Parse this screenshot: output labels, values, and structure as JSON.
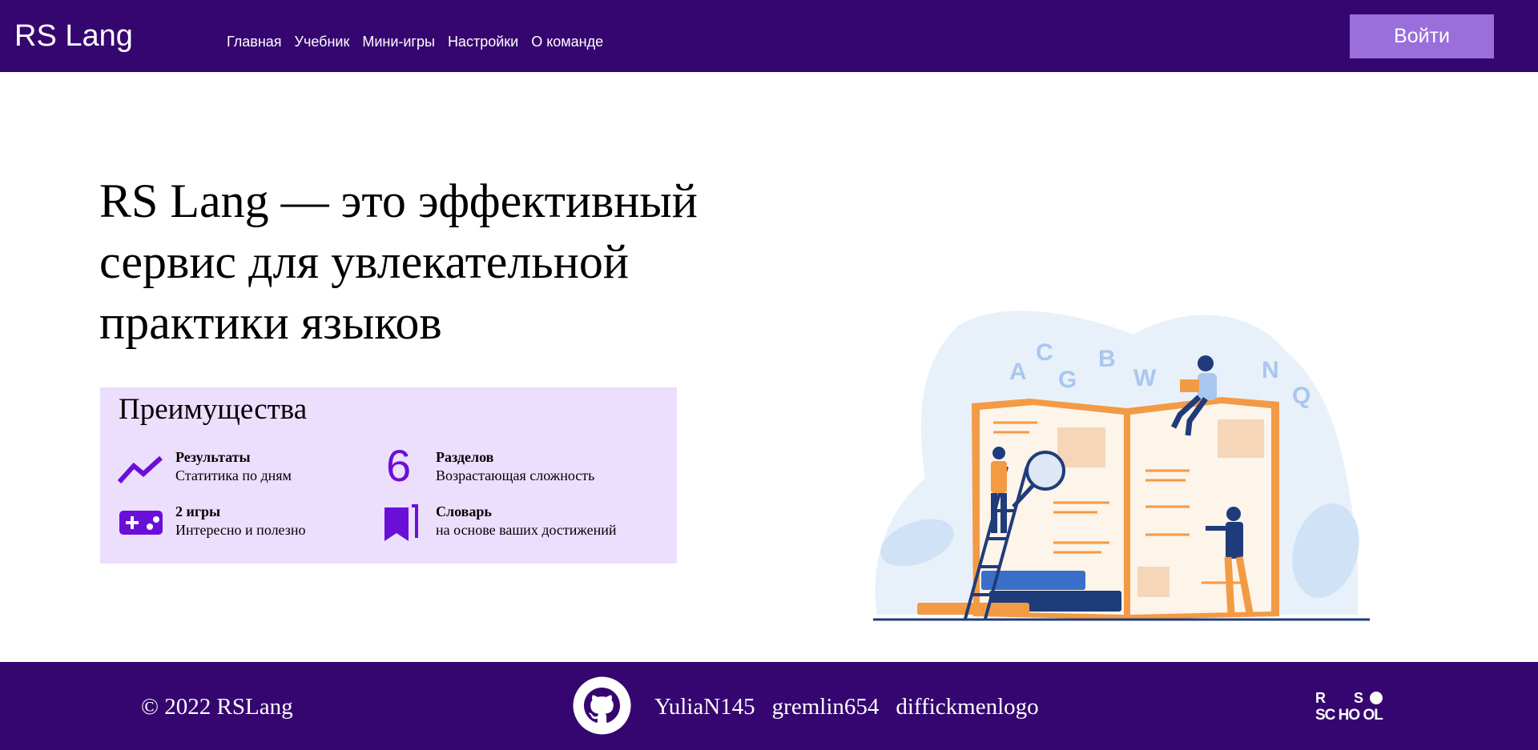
{
  "header": {
    "logo": "RS Lang",
    "nav": [
      "Главная",
      "Учебник",
      "Мини-игры",
      "Настройки",
      "О команде"
    ],
    "login_label": "Войти"
  },
  "hero": {
    "title": "RS Lang — это эффективный сервис для увлекательной практики языков"
  },
  "advantages": {
    "title": "Преимущества",
    "items": [
      {
        "title": "Результаты",
        "text": "Статитика по дням",
        "icon": "trending-up-icon"
      },
      {
        "title": "Разделов",
        "text": "Возрастающая сложность",
        "icon": "number-six-icon",
        "icon_text": "6"
      },
      {
        "title": "2 игры",
        "text": "Интересно и полезно",
        "icon": "gamepad-icon"
      },
      {
        "title": "Словарь",
        "text": "на основе ваших достижений",
        "icon": "book-icon"
      }
    ]
  },
  "illustration": {
    "letters": [
      "A",
      "C",
      "G",
      "B",
      "W",
      "N",
      "Q"
    ]
  },
  "footer": {
    "copyright": "© 2022 RSLang",
    "authors": [
      "YuliaN145",
      "gremlin654",
      "diffickmenlogo"
    ],
    "school_logo_text": "RS SCHOOL"
  },
  "colors": {
    "primary": "#360670",
    "button": "#9a6fdc",
    "accent": "#6a0fd8",
    "panel": "#ecdefd"
  }
}
